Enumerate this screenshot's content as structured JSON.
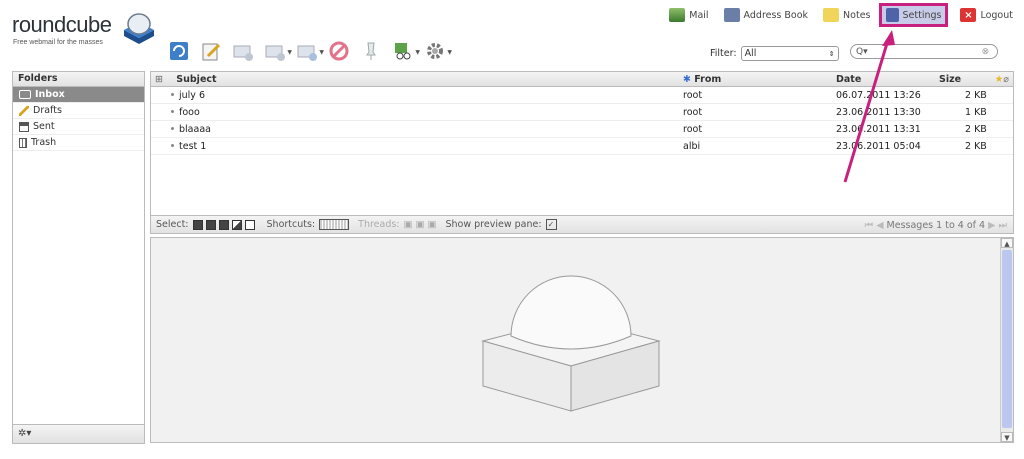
{
  "logo": {
    "name": "roundcube",
    "tagline": "Free webmail for the masses"
  },
  "nav": {
    "mail": "Mail",
    "address_book": "Address Book",
    "notes": "Notes",
    "settings": "Settings",
    "logout": "Logout"
  },
  "filter": {
    "label": "Filter:",
    "value": "All"
  },
  "search": {
    "placeholder": "",
    "value": ""
  },
  "folders": {
    "header": "Folders",
    "items": [
      {
        "label": "Inbox",
        "selected": true
      },
      {
        "label": "Drafts"
      },
      {
        "label": "Sent"
      },
      {
        "label": "Trash"
      }
    ]
  },
  "list": {
    "columns": {
      "subject": "Subject",
      "from": "From",
      "date": "Date",
      "size": "Size"
    },
    "rows": [
      {
        "subject": "july 6",
        "from": "root",
        "date": "06.07.2011 13:26",
        "size": "2 KB"
      },
      {
        "subject": "fooo",
        "from": "root",
        "date": "23.06.2011 13:30",
        "size": "1 KB"
      },
      {
        "subject": "blaaaa",
        "from": "root",
        "date": "23.06.2011 13:31",
        "size": "2 KB"
      },
      {
        "subject": "test 1",
        "from": "albi",
        "date": "23.06.2011 05:04",
        "size": "2 KB"
      }
    ],
    "footer": {
      "select": "Select:",
      "shortcuts": "Shortcuts:",
      "threads": "Threads:",
      "preview": "Show preview pane:",
      "pager": "Messages 1 to 4 of 4"
    }
  },
  "colors": {
    "highlight": "#c8207e",
    "selected_folder": "#8a8a8a"
  }
}
